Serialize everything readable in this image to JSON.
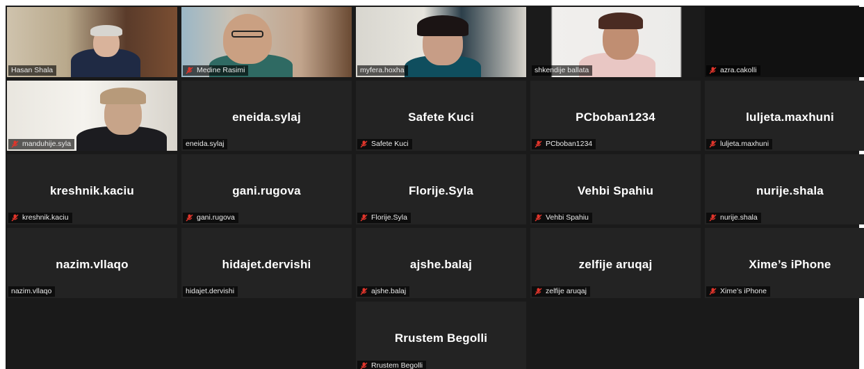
{
  "meeting": {
    "participants": [
      {
        "id": "hasan-shala",
        "tag": "Hasan Shala",
        "display": "",
        "video": true,
        "muted": false,
        "active": true
      },
      {
        "id": "medine-rasimi",
        "tag": "Medine Rasimi",
        "display": "",
        "video": true,
        "muted": true,
        "active": false
      },
      {
        "id": "myfera-hoxha",
        "tag": "myfera.hoxha",
        "display": "",
        "video": true,
        "muted": false,
        "active": false
      },
      {
        "id": "shkendije-ballata",
        "tag": "shkendije ballata",
        "display": "",
        "video": true,
        "muted": false,
        "active": false
      },
      {
        "id": "azra-cakolli",
        "tag": "azra.cakolli",
        "display": "",
        "video": false,
        "muted": true,
        "active": false
      },
      {
        "id": "manduhije-syla",
        "tag": "manduhije.syla",
        "display": "",
        "video": true,
        "muted": true,
        "active": false
      },
      {
        "id": "eneida-sylaj",
        "tag": "eneida.sylaj",
        "display": "eneida.sylaj",
        "video": false,
        "muted": false,
        "active": false
      },
      {
        "id": "safete-kuci",
        "tag": "Safete Kuci",
        "display": "Safete Kuci",
        "video": false,
        "muted": true,
        "active": false
      },
      {
        "id": "pcboban1234",
        "tag": "PCboban1234",
        "display": "PCboban1234",
        "video": false,
        "muted": true,
        "active": false
      },
      {
        "id": "luljeta-maxhuni",
        "tag": "luljeta.maxhuni",
        "display": "luljeta.maxhuni",
        "video": false,
        "muted": true,
        "active": false
      },
      {
        "id": "kreshnik-kaciu",
        "tag": "kreshnik.kaciu",
        "display": "kreshnik.kaciu",
        "video": false,
        "muted": true,
        "active": false
      },
      {
        "id": "gani-rugova",
        "tag": "gani.rugova",
        "display": "gani.rugova",
        "video": false,
        "muted": true,
        "active": false
      },
      {
        "id": "florije-syla",
        "tag": "Florije.Syla",
        "display": "Florije.Syla",
        "video": false,
        "muted": true,
        "active": false
      },
      {
        "id": "vehbi-spahiu",
        "tag": "Vehbi Spahiu",
        "display": "Vehbi Spahiu",
        "video": false,
        "muted": true,
        "active": false
      },
      {
        "id": "nurije-shala",
        "tag": "nurije.shala",
        "display": "nurije.shala",
        "video": false,
        "muted": true,
        "active": false
      },
      {
        "id": "nazim-vllaqo",
        "tag": "nazim.vllaqo",
        "display": "nazim.vllaqo",
        "video": false,
        "muted": false,
        "active": false
      },
      {
        "id": "hidajet-dervishi",
        "tag": "hidajet.dervishi",
        "display": "hidajet.dervishi",
        "video": false,
        "muted": false,
        "active": false
      },
      {
        "id": "ajshe-balaj",
        "tag": "ajshe.balaj",
        "display": "ajshe.balaj",
        "video": false,
        "muted": true,
        "active": false
      },
      {
        "id": "zelfije-aruqaj",
        "tag": "zelfije aruqaj",
        "display": "zelfije aruqaj",
        "video": false,
        "muted": true,
        "active": false
      },
      {
        "id": "xime-iphone",
        "tag": "Xime’s iPhone",
        "display": "Xime’s iPhone",
        "video": false,
        "muted": true,
        "active": false
      },
      {
        "id": "rrustem-begolli",
        "tag": "Rrustem Begolli",
        "display": "Rrustem Begolli",
        "video": false,
        "muted": true,
        "active": false
      }
    ]
  },
  "colors": {
    "grid_background": "#1a1a1a",
    "tile_background": "#232323",
    "active_speaker_outline": "#f2e35c",
    "muted_icon": "#e0352b"
  },
  "icons": {
    "muted": "microphone-muted-icon"
  }
}
